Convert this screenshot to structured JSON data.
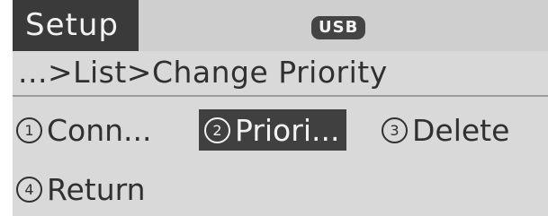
{
  "header": {
    "title": "Setup",
    "source_badge": "USB"
  },
  "breadcrumb": "...>List>Change Priority",
  "menu": {
    "items": [
      {
        "number": "1",
        "label": "Conn...",
        "selected": false
      },
      {
        "number": "2",
        "label": "Priori...",
        "selected": true
      },
      {
        "number": "3",
        "label": "Delete",
        "selected": false
      },
      {
        "number": "4",
        "label": "Return",
        "selected": false
      }
    ]
  },
  "colors": {
    "background": "#d9d9d9",
    "header_background": "#cfcfcf",
    "highlight": "#404040",
    "text": "#303030",
    "highlight_text": "#f3f3f3"
  }
}
